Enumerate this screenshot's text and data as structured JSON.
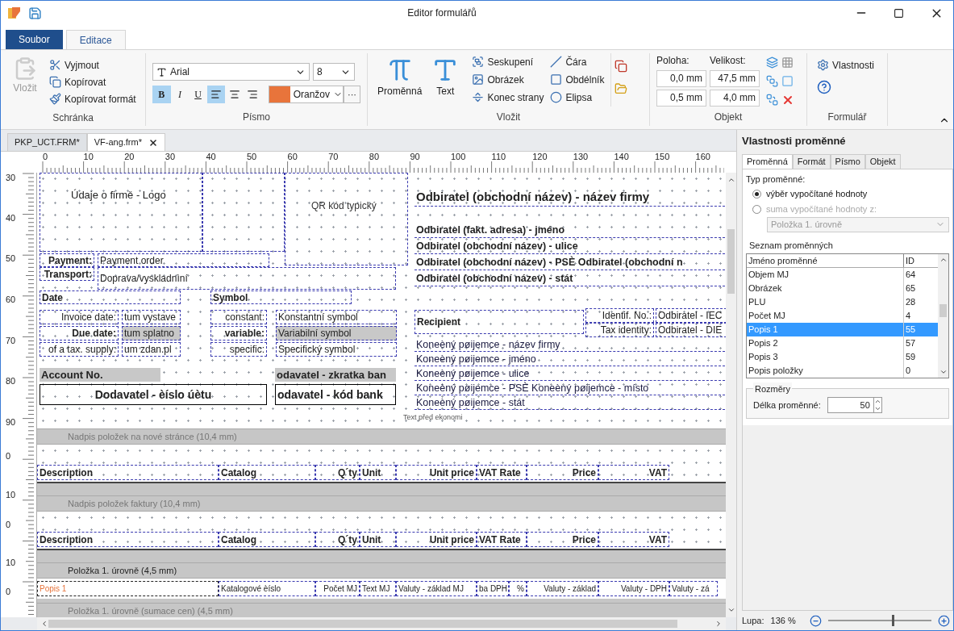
{
  "window": {
    "title": "Editor formulářů"
  },
  "ribbon": {
    "tabs": [
      {
        "label": "Soubor",
        "kind": "file",
        "selected": false
      },
      {
        "label": "Editace",
        "kind": "tab",
        "selected": true
      }
    ],
    "clipboard": {
      "paste": {
        "label": "Vložit",
        "disabled": true
      },
      "actions": [
        {
          "label": "Vyjmout",
          "kind": "cut"
        },
        {
          "label": "Kopírovat",
          "kind": "copy"
        },
        {
          "label": "Kopírovat formát",
          "kind": "format"
        }
      ],
      "title": "Schránka"
    },
    "font": {
      "family": "Arial",
      "size": "8",
      "styles": [
        {
          "label": "B",
          "kind": "bold",
          "selected": true
        },
        {
          "label": "I",
          "kind": "italic",
          "selected": false
        },
        {
          "label": "U",
          "kind": "underline",
          "selected": false
        }
      ],
      "align": [
        {
          "kind": "left",
          "selected": true
        },
        {
          "kind": "center",
          "selected": false
        },
        {
          "kind": "right",
          "selected": false
        }
      ],
      "color": {
        "label": "Oranžov",
        "color": "#e8743b"
      },
      "more": "···",
      "title": "Písmo"
    },
    "insert": {
      "large": [
        {
          "label": "Proměnná",
          "kind": "variable"
        },
        {
          "label": "Text",
          "kind": "text"
        }
      ],
      "small": [
        {
          "label": "Seskupení",
          "kind": "group"
        },
        {
          "label": "Obrázek",
          "kind": "image"
        },
        {
          "label": "Konec strany",
          "kind": "break"
        },
        {
          "label": "Čára",
          "kind": "line"
        },
        {
          "label": "Obdélník",
          "kind": "rect"
        },
        {
          "label": "Elipsa",
          "kind": "ellipse"
        }
      ],
      "title": "Vložit"
    },
    "object": {
      "position_label": "Poloha:",
      "size_label": "Velikost:",
      "position": [
        "0,0 mm",
        "0,5 mm"
      ],
      "size": [
        "47,5 mm",
        "4,0 mm"
      ],
      "title": "Objekt"
    },
    "form": {
      "properties": "Vlastnosti",
      "title": "Formulář"
    }
  },
  "documents": [
    {
      "label": "PKP_UCT.FRM*",
      "selected": false,
      "closable": false
    },
    {
      "label": "VF-ang.frm*",
      "selected": true,
      "closable": true
    }
  ],
  "rulers": {
    "horizontal": [
      "0",
      "10",
      "20",
      "30",
      "40",
      "50",
      "60",
      "70",
      "80",
      "90",
      "100",
      "110",
      "120",
      "130",
      "140",
      "150",
      "160"
    ],
    "vertical": [
      "30",
      "40",
      "50",
      "60",
      "70",
      "80",
      "90",
      "0",
      "10",
      "0",
      "10",
      "0"
    ]
  },
  "form": {
    "header_items": [
      {
        "text": "Údaje o firmě - Logo",
        "kind": "plain"
      },
      {
        "text": "QR kód typický",
        "kind": "light"
      },
      {
        "text": "Odbiratel (obchodní název) - název firmy",
        "kind": "title"
      },
      {
        "text": "Odbiratel (fakt. adresa) - jméno",
        "kind": "bold"
      },
      {
        "text": "Odbiratel (obchodní název) - ulice",
        "kind": "bold"
      },
      {
        "text": "Odbiratel (obchodní název) - PSÈ  Odbiratel (obchodní n",
        "kind": "bold"
      },
      {
        "text": "Odbiratel (obchodní název) - stát",
        "kind": "bold"
      },
      {
        "text": "Payment:",
        "kind": "heading"
      },
      {
        "text": "Payment order",
        "kind": "label"
      },
      {
        "text": "Transport:",
        "kind": "heading"
      },
      {
        "text": "Doprava/vyskladnìní",
        "kind": "label"
      },
      {
        "text": "Date",
        "kind": "heading"
      },
      {
        "text": "Symbol",
        "kind": "heading"
      },
      {
        "text": "Invoice date:",
        "kind": "label"
      },
      {
        "text": "tum vystave",
        "kind": "label"
      },
      {
        "text": "constant:",
        "kind": "label"
      },
      {
        "text": "Konstantní symbol",
        "kind": "label"
      },
      {
        "text": "Due date:",
        "kind": "heading"
      },
      {
        "text": "tum splatno",
        "kind": "shaded"
      },
      {
        "text": "variable:",
        "kind": "heading"
      },
      {
        "text": "Variabilní symbol",
        "kind": "shaded"
      },
      {
        "text": "of a tax. supply:",
        "kind": "label"
      },
      {
        "text": "um zdan.pl",
        "kind": "label"
      },
      {
        "text": "specific:",
        "kind": "label"
      },
      {
        "text": "Specifický symbol",
        "kind": "label"
      },
      {
        "text": "Account No.",
        "kind": "shaded_bold"
      },
      {
        "text": "Dodavatel - èíslo úètu",
        "kind": "boxed"
      },
      {
        "text": "odavatel - zkratka ban",
        "kind": "shaded_bold"
      },
      {
        "text": "odavatel - kód bank",
        "kind": "boxed"
      },
      {
        "text": "Recipient",
        "kind": "heading"
      },
      {
        "text": "Identif. No.:",
        "kind": "label"
      },
      {
        "text": "Odbiratel - IEC",
        "kind": "label"
      },
      {
        "text": "Tax identity:",
        "kind": "label"
      },
      {
        "text": "Odbiratel - DIE",
        "kind": "label"
      },
      {
        "text": "Koneèný pøijemce - název firmy",
        "kind": "line"
      },
      {
        "text": "Koneèný pøijemce - jméno",
        "kind": "line"
      },
      {
        "text": "Koneèný pøijemce - ulice",
        "kind": "line"
      },
      {
        "text": "Koneèný pøijemce - PSÈ  Koneèný pøijemce - místo",
        "kind": "line"
      },
      {
        "text": "Koneèný pøijemce - stát",
        "kind": "line"
      },
      {
        "text": "Text před ekonomi",
        "kind": "note"
      }
    ],
    "sections": [
      {
        "title": "Nadpis položek na nové stránce (10,4 mm)",
        "active": false,
        "kind": "header",
        "cells": [
          {
            "text": "Description"
          },
          {
            "text": "Catalog"
          },
          {
            "text": "Q´ty"
          },
          {
            "text": "Unit"
          },
          {
            "text": "Unit price"
          },
          {
            "text": "VAT Rate"
          },
          {
            "text": "Price"
          },
          {
            "text": "VAT"
          }
        ]
      },
      {
        "title": "Nadpis položek faktury (10,4 mm)",
        "active": false,
        "kind": "header",
        "cells": [
          {
            "text": "Description"
          },
          {
            "text": "Catalog"
          },
          {
            "text": "Q´ty"
          },
          {
            "text": "Unit"
          },
          {
            "text": "Unit price"
          },
          {
            "text": "VAT Rate"
          },
          {
            "text": "Price"
          },
          {
            "text": "VAT"
          }
        ]
      },
      {
        "title": "Položka 1. úrovně (4,5 mm)",
        "active": true,
        "kind": "item",
        "cells": [
          {
            "text": "Popis 1",
            "selected": true
          },
          {
            "text": "Katalogové èíslo",
            "selected": false
          },
          {
            "text": "Počet MJ",
            "selected": false
          },
          {
            "text": "Text MJ",
            "selected": false
          },
          {
            "text": "Valuty - základ MJ",
            "selected": false
          },
          {
            "text": "ba DPH",
            "selected": false
          },
          {
            "text": "%",
            "selected": false
          },
          {
            "text": "Valuty - základ",
            "selected": false
          },
          {
            "text": "Valuty - DPH",
            "selected": false
          },
          {
            "text": "Valuty - zá",
            "selected": false
          }
        ]
      },
      {
        "title": "Položka 1. úrovně (sumace cen) (4,5 mm)",
        "active": false,
        "kind": "summary"
      }
    ]
  },
  "properties": {
    "title": "Vlastnosti proměnné",
    "tabs": [
      {
        "label": "Proměnná",
        "selected": true
      },
      {
        "label": "Formát",
        "selected": false
      },
      {
        "label": "Písmo",
        "selected": false
      },
      {
        "label": "Objekt",
        "selected": false
      }
    ],
    "type_label": "Typ proměnné:",
    "options": [
      {
        "label": "výběr vypočítané hodnoty",
        "selected": true,
        "disabled": false
      },
      {
        "label": "suma vypočítané hodnoty z:",
        "selected": false,
        "disabled": true
      }
    ],
    "source": {
      "value": "Položka 1. úrovně",
      "disabled": true
    },
    "list_title": "Seznam proměnných",
    "columns": [
      "Jméno proměnné",
      "ID"
    ],
    "rows": [
      {
        "name": "Objem MJ",
        "id": "64",
        "selected": false
      },
      {
        "name": "Obrázek",
        "id": "65",
        "selected": false
      },
      {
        "name": "PLU",
        "id": "28",
        "selected": false
      },
      {
        "name": "Počet MJ",
        "id": "4",
        "selected": false
      },
      {
        "name": "Popis 1",
        "id": "55",
        "selected": true
      },
      {
        "name": "Popis 2",
        "id": "57",
        "selected": false
      },
      {
        "name": "Popis 3",
        "id": "59",
        "selected": false
      },
      {
        "name": "Popis položky",
        "id": "0",
        "selected": false
      }
    ],
    "dimensions": {
      "title": "Rozměry",
      "label": "Délka proměnné:",
      "value": "50"
    }
  },
  "zoom": {
    "label": "Lupa:",
    "value": "136 %",
    "level": 0.63
  }
}
